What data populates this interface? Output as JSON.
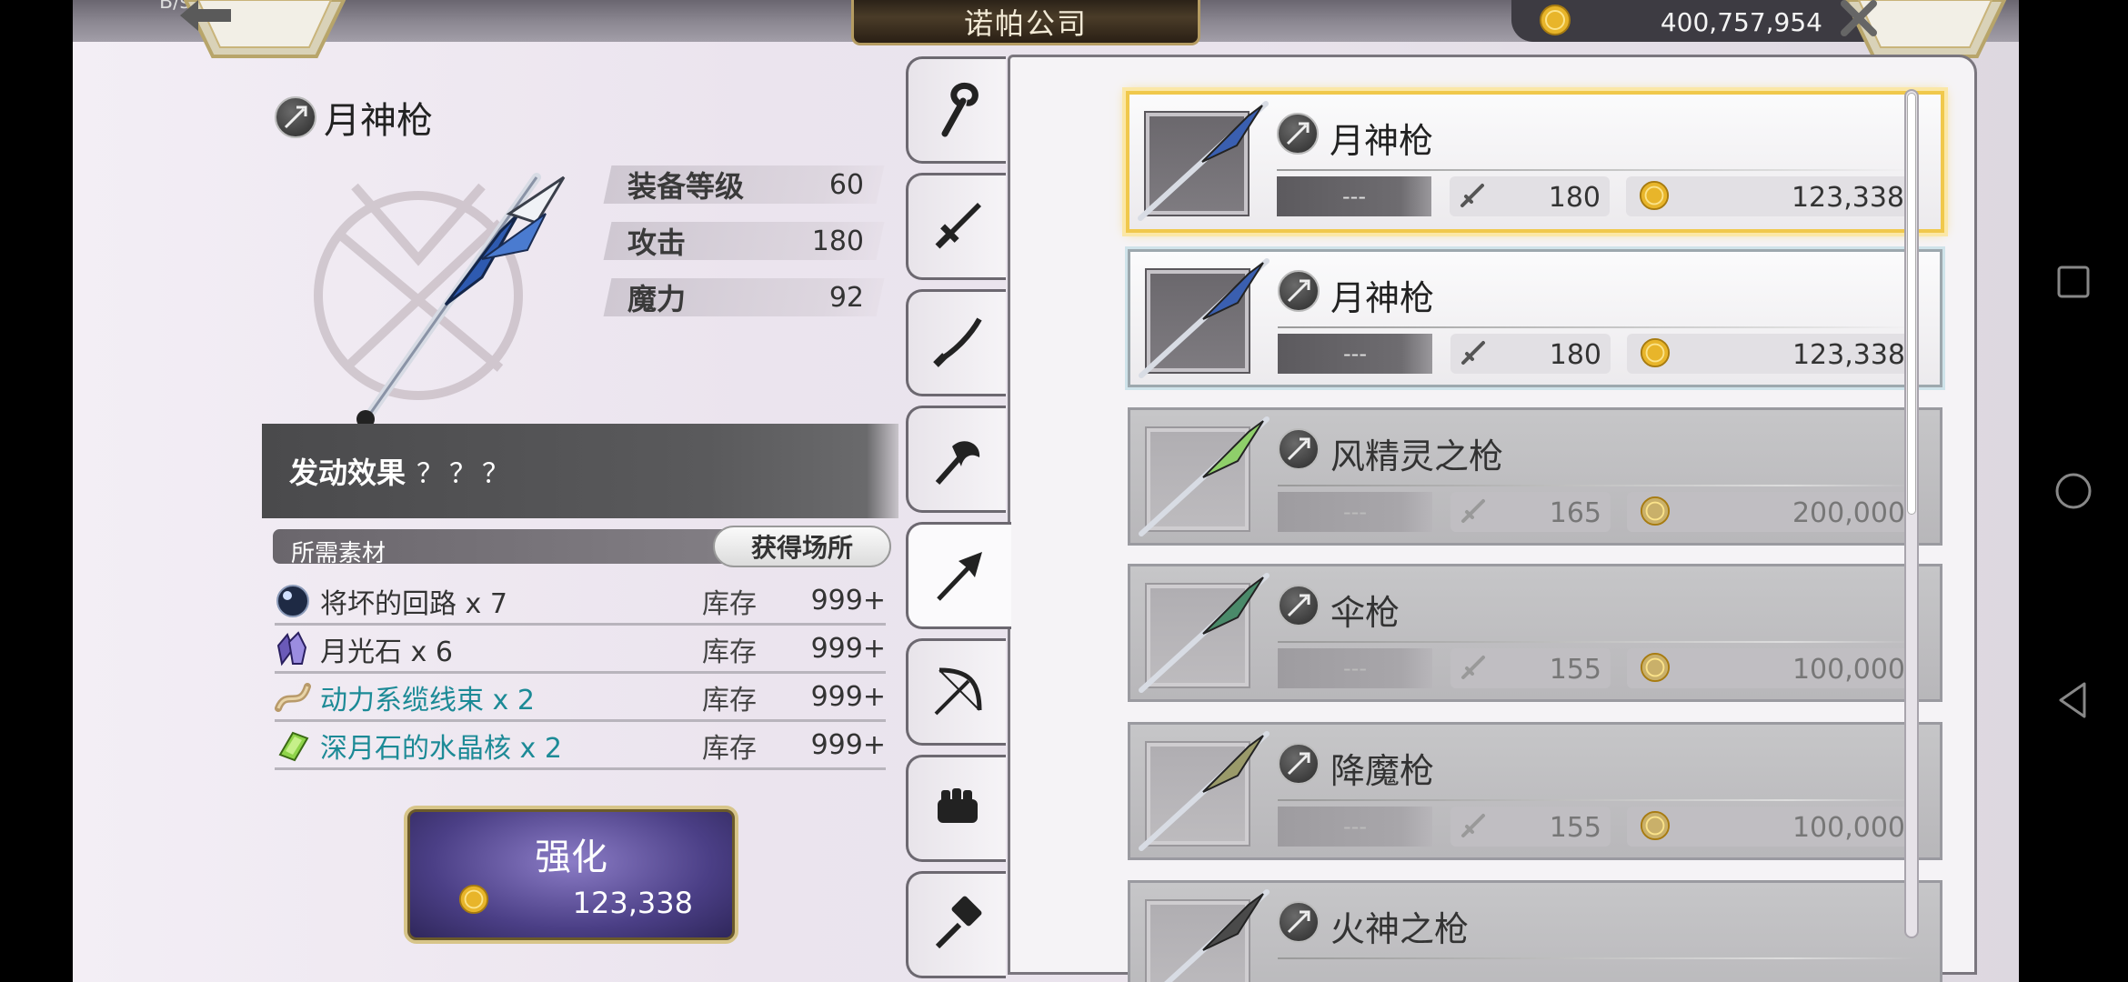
{
  "statusbar": {
    "text": "B/s"
  },
  "header": {
    "title": "诺帕公司",
    "gold": "400,757,954",
    "back_icon": "arrow-left-icon",
    "close_icon": "close-icon"
  },
  "detail": {
    "name": "月神枪",
    "stats": [
      {
        "label": "装备等级",
        "value": "60"
      },
      {
        "label": "攻击",
        "value": "180"
      },
      {
        "label": "魔力",
        "value": "92"
      }
    ],
    "effect_label": "发动效果",
    "effect_value": "？？？",
    "materials_label": "所需素材",
    "source_button": "获得场所",
    "materials": [
      {
        "name": "将坏的回路 x 7",
        "stock_label": "库存",
        "stock": "999+",
        "highlight": false,
        "icon": "orb-icon"
      },
      {
        "name": "月光石 x 6",
        "stock_label": "库存",
        "stock": "999+",
        "highlight": false,
        "icon": "crystal-cluster-icon"
      },
      {
        "name": "动力系缆线束 x 2",
        "stock_label": "库存",
        "stock": "999+",
        "highlight": true,
        "icon": "cable-bundle-icon"
      },
      {
        "name": "深月石的水晶核 x 2",
        "stock_label": "库存",
        "stock": "999+",
        "highlight": true,
        "icon": "green-crystal-icon"
      }
    ],
    "upgrade_label": "强化",
    "upgrade_cost": "123,338"
  },
  "tabs": [
    {
      "icon": "staff-icon",
      "active": false
    },
    {
      "icon": "sword-icon",
      "active": false
    },
    {
      "icon": "katana-icon",
      "active": false
    },
    {
      "icon": "axe-icon",
      "active": false
    },
    {
      "icon": "spear-icon",
      "active": true
    },
    {
      "icon": "bow-icon",
      "active": false
    },
    {
      "icon": "gauntlet-icon",
      "active": false
    },
    {
      "icon": "hammer-icon",
      "active": false
    }
  ],
  "weapons": [
    {
      "name": "月神枪",
      "level": "---",
      "attack": "180",
      "price": "123,338",
      "state": "selected",
      "color": "#3a5fb0"
    },
    {
      "name": "月神枪",
      "level": "---",
      "attack": "180",
      "price": "123,338",
      "state": "owned",
      "color": "#3a5fb0"
    },
    {
      "name": "风精灵之枪",
      "level": "---",
      "attack": "165",
      "price": "200,000",
      "state": "locked",
      "color": "#8fcf6a"
    },
    {
      "name": "伞枪",
      "level": "---",
      "attack": "155",
      "price": "100,000",
      "state": "locked",
      "color": "#4a8a6a"
    },
    {
      "name": "降魔枪",
      "level": "---",
      "attack": "155",
      "price": "100,000",
      "state": "locked",
      "color": "#9a9a6a"
    },
    {
      "name": "火神之枪",
      "level": "",
      "attack": "",
      "price": "",
      "state": "locked",
      "color": "#4a4a4a"
    }
  ],
  "navbar": {
    "icons": [
      "recent-apps-icon",
      "home-icon",
      "back-icon"
    ]
  },
  "colors": {
    "accent_gold": "#f0c84c",
    "teal_text": "#1c8a96",
    "upgrade_purple": "#4b3f86"
  }
}
